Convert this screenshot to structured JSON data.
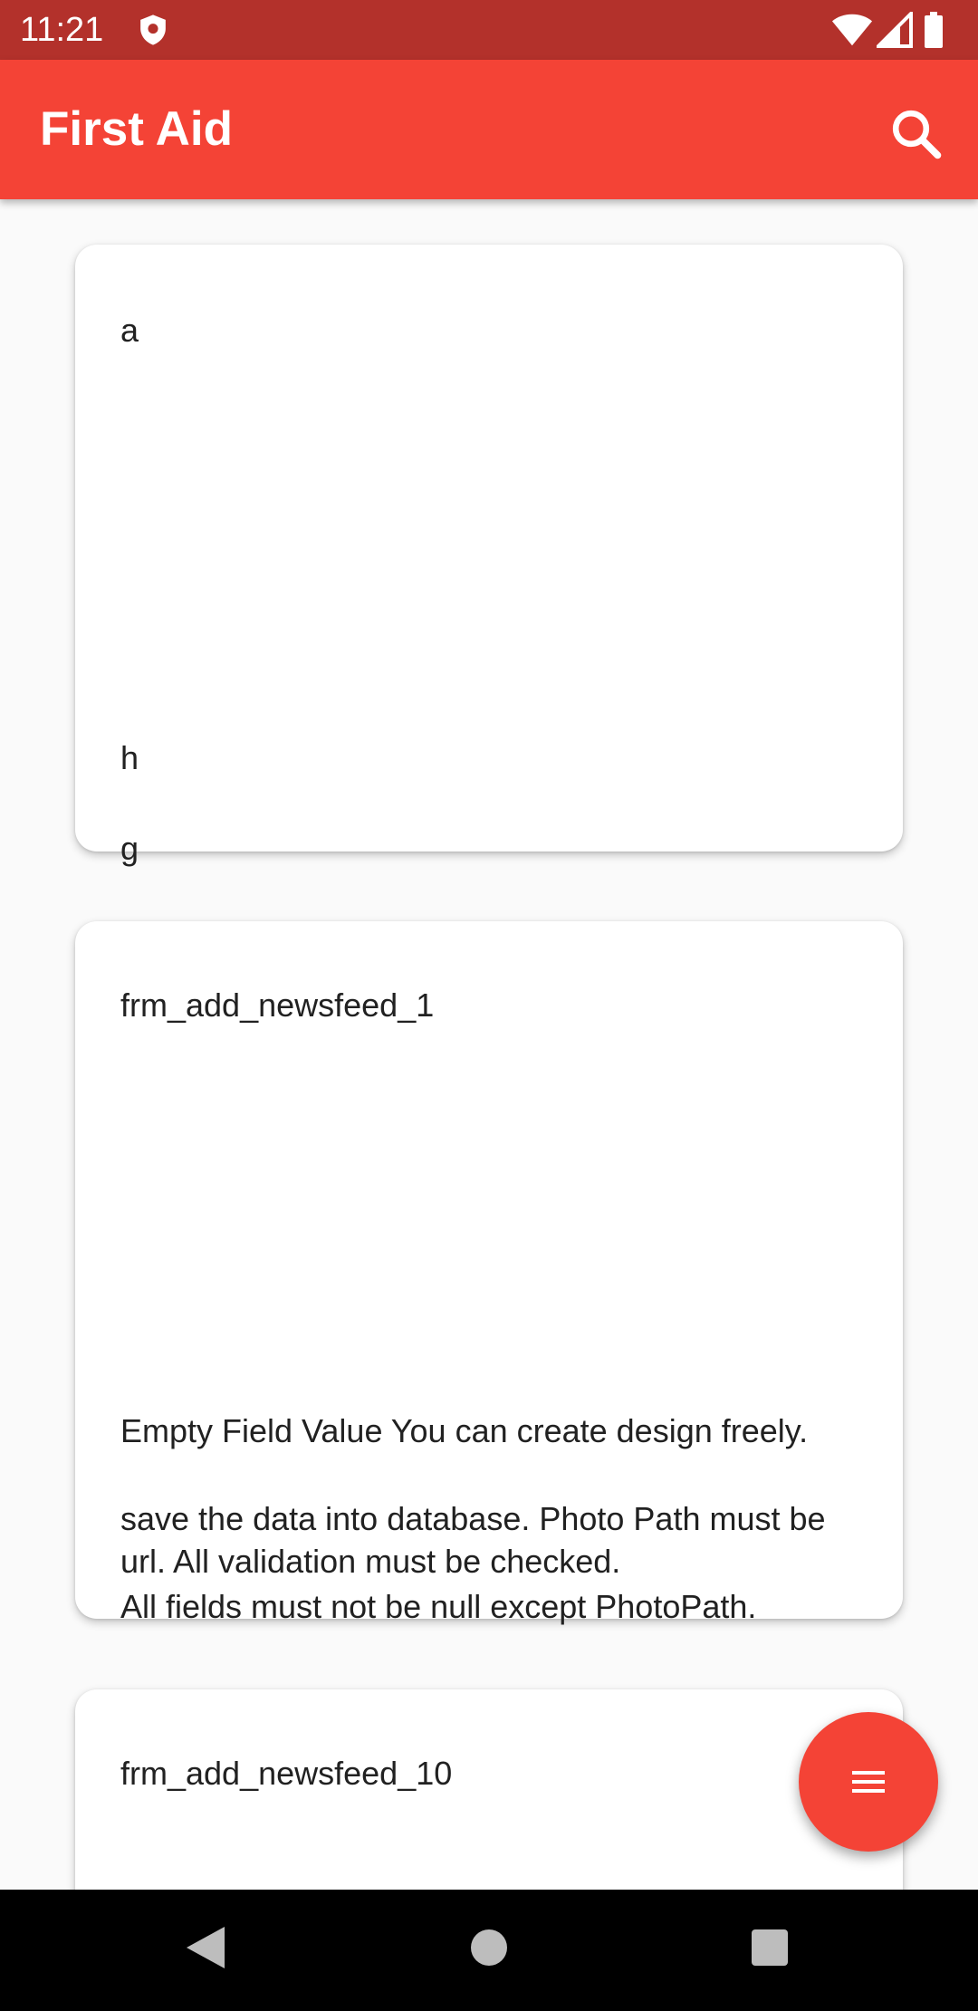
{
  "status_bar": {
    "time": "11:21"
  },
  "app_bar": {
    "title": "First Aid",
    "search_icon": "search-icon"
  },
  "cards": [
    {
      "title": "a",
      "line1": "h",
      "line2": "g"
    },
    {
      "title": "frm_add_newsfeed_1",
      "line1": "Empty Field Value You can create design freely.",
      "line2": "save the data into database. Photo Path must be url. All validation must be checked.",
      "line3": "All fields must not be null except PhotoPath."
    },
    {
      "title": "frm_add_newsfeed_10"
    }
  ],
  "fab": {
    "icon": "menu-icon"
  },
  "colors": {
    "status_bar": "#b3312b",
    "app_bar": "#f44336",
    "fab": "#f44336",
    "background": "#fafafa"
  }
}
